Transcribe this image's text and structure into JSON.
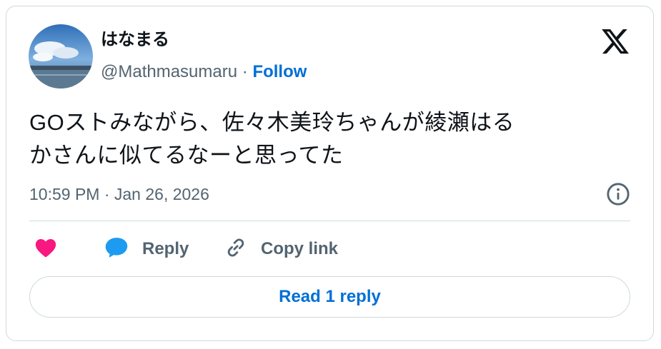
{
  "author": {
    "display_name": "はなまる",
    "handle": "@Mathmasumaru",
    "separator": "·",
    "follow_label": "Follow",
    "avatar_icon": "avatar-sky-landscape"
  },
  "tweet": {
    "text_line1": "GOストみながら、佐々木美玲ちゃんが綾瀬はる",
    "text_line2": "かさんに似てるなーと思ってた",
    "timestamp": "10:59 PM · Jan 26, 2026"
  },
  "actions": {
    "like_icon": "heart-icon",
    "reply_label": "Reply",
    "reply_icon": "speech-bubble-icon",
    "copy_label": "Copy link",
    "copy_icon": "link-icon"
  },
  "read_replies_label": "Read 1 reply",
  "colors": {
    "accent": "#006fd6",
    "like": "#f91880",
    "reply": "#1d9bf0",
    "muted": "#536471",
    "text": "#0f1419",
    "border": "#cfd9de"
  }
}
